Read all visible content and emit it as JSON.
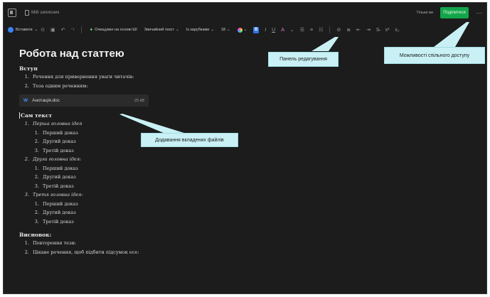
{
  "topbar": {
    "notebook": "Мій записник",
    "view_only": "Тільки ви",
    "share_label": "Поділитися",
    "more": "···"
  },
  "toolbar": {
    "insert": "Вставити",
    "ai_label": "Очищувач на основі ШІ",
    "style": "Звичайний текст",
    "font": "Із зарубками",
    "font_size": "18",
    "bold": "B",
    "italic": "I",
    "underline": "U",
    "font_color": "A",
    "superscript": "x²",
    "subscript": "x₂"
  },
  "document": {
    "title": "Робота над статтею",
    "intro_heading": "Вступ",
    "intro_items": [
      "Речення для привернення уваги читачів:",
      "Теза одним реченням:"
    ],
    "attachment": {
      "name": "Анотація.doc",
      "size": "25 kB",
      "icon": "W"
    },
    "body_heading": "Сам текст",
    "ideas": [
      {
        "label": "Перша головна ідея",
        "points": [
          "Перший доказ",
          "Другий доказ",
          "Третій доказ"
        ]
      },
      {
        "label": "Друга головна ідея:",
        "points": [
          "Перший доказ",
          "Другий доказ",
          "Третій доказ"
        ]
      },
      {
        "label": "Третя головна ідея:",
        "points": [
          "Перший доказ",
          "Другий доказ",
          "Третій доказ"
        ]
      }
    ],
    "conclusion_heading": "Висновок:",
    "conclusion_items": [
      "Повторення тези:",
      "Цікаве речення, щоб підбити підсумок есе:"
    ]
  },
  "callouts": {
    "toolbar": "Панель редагування",
    "share": "Можливості спільного доступу",
    "attachments": "Додавання вкладених файлів"
  },
  "colors": {
    "background": "#1c1c1c",
    "share_button": "#12a54a",
    "callout": "#c9f1f5",
    "accent_blue": "#2d74e6"
  }
}
